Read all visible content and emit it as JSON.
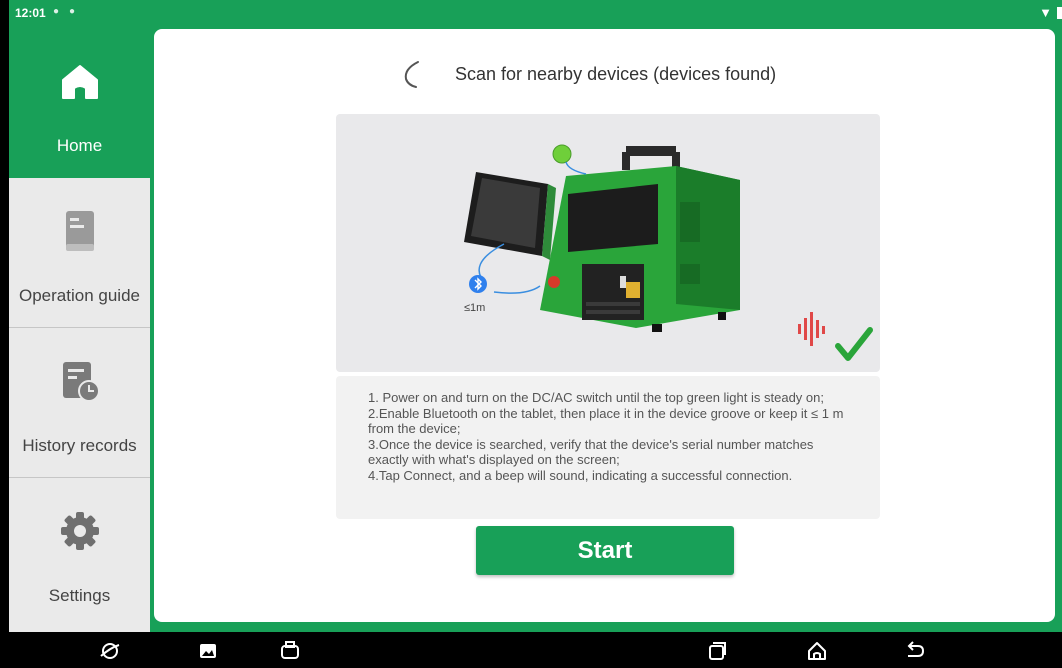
{
  "status_bar": {
    "time": "12:01"
  },
  "sidebar": {
    "items": [
      {
        "label": "Home",
        "icon": "home-icon"
      },
      {
        "label": "Operation guide",
        "icon": "book-icon"
      },
      {
        "label": "History records",
        "icon": "history-icon"
      },
      {
        "label": "Settings",
        "icon": "gear-icon"
      }
    ]
  },
  "main": {
    "scan_title": "Scan for nearby devices (devices found)",
    "illustration": {
      "distance_label": "≤1m"
    },
    "instructions": [
      "1. Power on and turn on the DC/AC switch until the top green light is steady on;",
      "2.Enable Bluetooth on the tablet, then place it in the device groove or keep it ≤ 1 m from the device;",
      "3.Once the device is searched, verify that the device's serial number matches exactly with what's displayed on the screen;",
      "4.Tap Connect, and a beep will sound, indicating a successful connection."
    ],
    "start_label": "Start"
  },
  "colors": {
    "accent": "#18a058",
    "panel_bg": "#ffffff",
    "sidebar_bg": "#eaeaea"
  },
  "nav_bar": {
    "icons": [
      "browser-icon",
      "gallery-icon",
      "vci-icon",
      "recents-icon",
      "home-nav-icon",
      "back-icon"
    ]
  }
}
